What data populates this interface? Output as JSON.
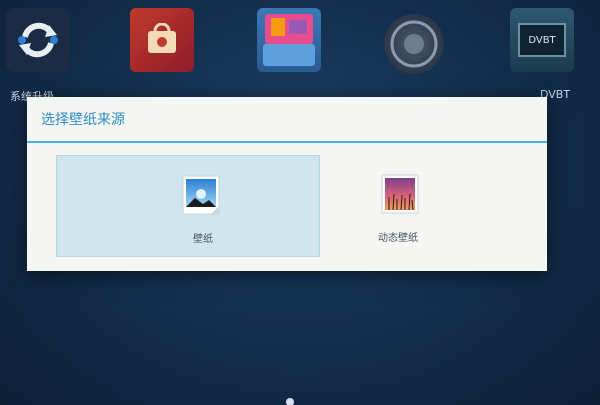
{
  "launcher": {
    "apps": [
      {
        "label": "系统升级",
        "icon": "sync-icon"
      },
      {
        "label": "",
        "icon": "store-icon"
      },
      {
        "label": "",
        "icon": "files-icon"
      },
      {
        "label": "",
        "icon": "settings-icon"
      },
      {
        "label": "DVBT",
        "icon": "tv-icon"
      }
    ],
    "dvbt_screen_text": "DVBT"
  },
  "dialog": {
    "title": "选择壁纸来源",
    "options": [
      {
        "label": "壁纸",
        "icon": "wallpaper-image-icon",
        "selected": true
      },
      {
        "label": "动态壁纸",
        "icon": "live-wallpaper-icon",
        "selected": false
      }
    ]
  },
  "colors": {
    "accent": "#45b2e0",
    "title": "#2c8ec4",
    "selected_bg": "#cfe6ee",
    "dialog_bg": "#f5f5f3"
  }
}
